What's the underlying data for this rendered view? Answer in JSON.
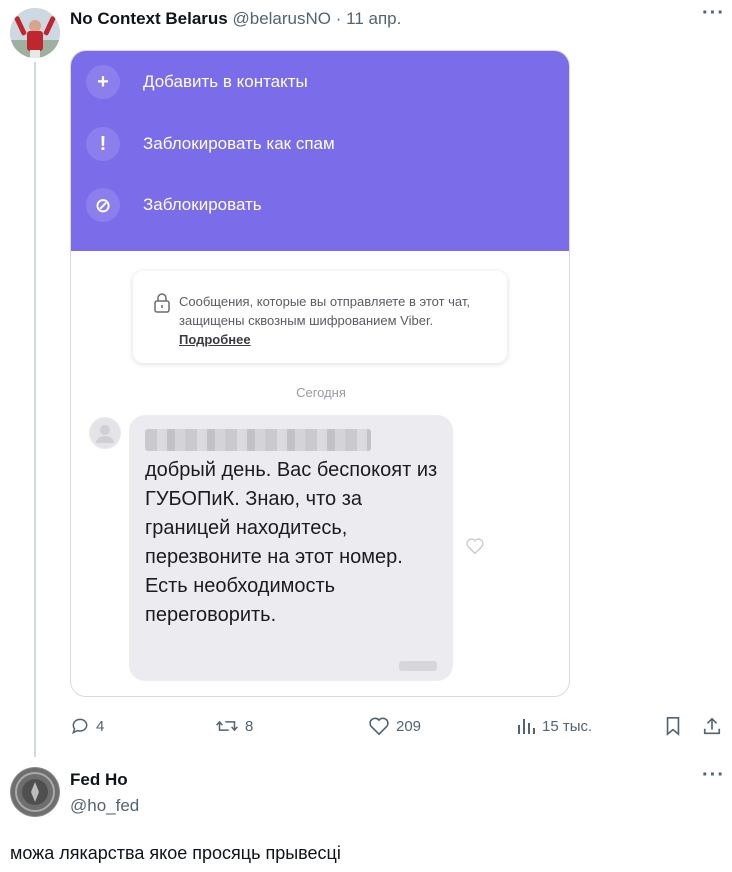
{
  "tweet": {
    "author_name": "No Context Belarus",
    "handle": "@belarusNO",
    "separator": "·",
    "date": "11 апр.",
    "more_icon": "more-horizontal-icon",
    "stats": {
      "replies": "4",
      "reposts": "8",
      "likes": "209",
      "views": "15 тыс."
    }
  },
  "screenshot": {
    "menu_color": "#7b6ce9",
    "menu": [
      {
        "icon": "plus-icon",
        "glyph": "+",
        "label": "Добавить в контакты"
      },
      {
        "icon": "exclamation-icon",
        "glyph": "!",
        "label": "Заблокировать как спам"
      },
      {
        "icon": "block-icon",
        "glyph": "⊘",
        "label": "Заблокировать"
      }
    ],
    "encryption_text": "Сообщения, которые вы отправляете в этот чат, защищены сквозным шифрованием Viber.",
    "encryption_link": "Подробнее",
    "date_divider": "Сегодня",
    "message": "добрый день. Вас беспокоят из ГУБОПиК. Знаю, что за границей находитесь, перезвоните на этот номер. Есть необходимость переговорить."
  },
  "reply": {
    "author_name": "Fed Ho",
    "handle": "@ho_fed",
    "text": "можа лякарства якое просяць прывесці"
  }
}
